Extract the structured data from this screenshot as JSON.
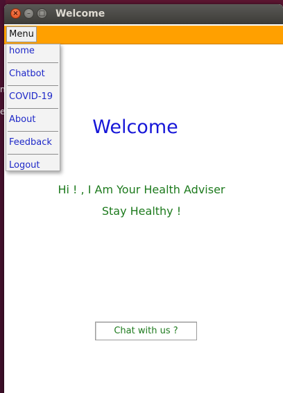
{
  "window": {
    "title": "Welcome",
    "controls": {
      "close_glyph": "×",
      "minimize_glyph": "–",
      "maximize_glyph": "□"
    }
  },
  "menubar": {
    "menu_label": "Menu",
    "background": "#ffa000"
  },
  "dropdown": {
    "items": [
      {
        "label": "home"
      },
      {
        "label": "Chatbot"
      },
      {
        "label": "COVID-19"
      },
      {
        "label": "About"
      },
      {
        "label": "Feedback"
      },
      {
        "label": "Logout"
      }
    ]
  },
  "main": {
    "heading": "Welcome",
    "greeting": "Hi ! , I Am Your Health Adviser",
    "tagline": "Stay Healthy !",
    "chat_button": "Chat with us ?"
  },
  "desktop": {
    "fragments": [
      "n",
      "e"
    ]
  },
  "colors": {
    "heading": "#1616d8",
    "text_green": "#1d7a1d",
    "menu_link": "#1e28c8"
  }
}
